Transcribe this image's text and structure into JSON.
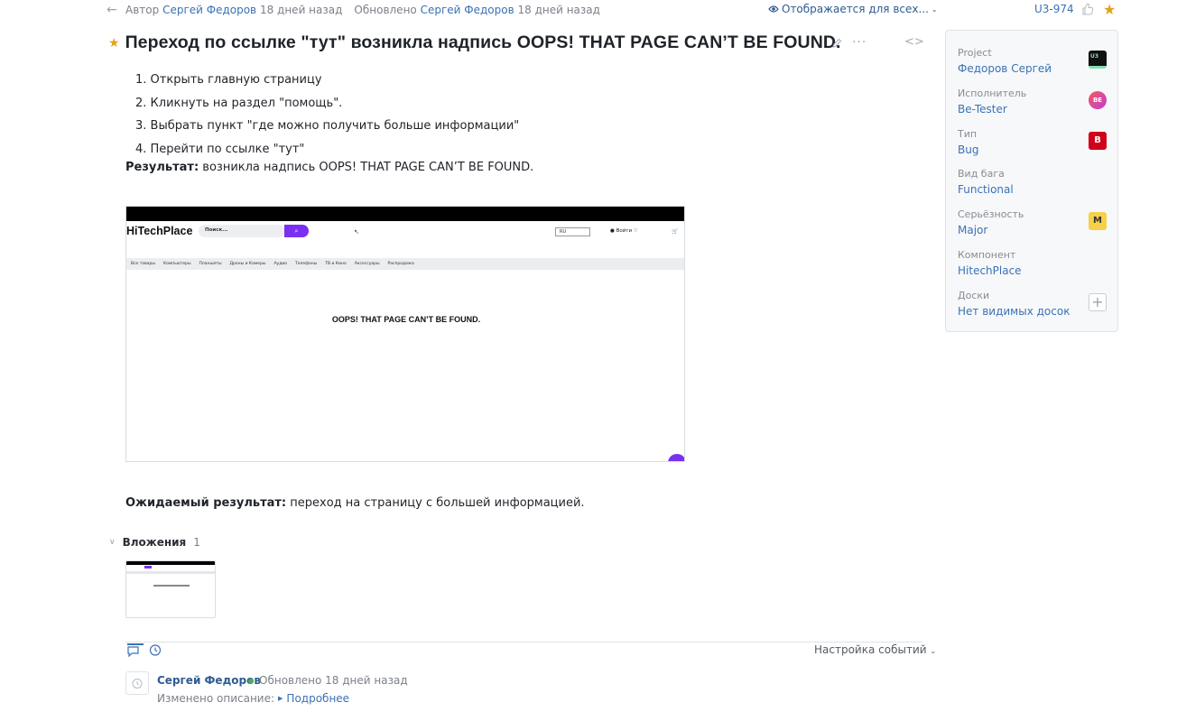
{
  "topbar": {
    "author_prefix": "Автор",
    "author_name": "Сергей Федоров",
    "author_time": "18 дней назад",
    "updated_prefix": "Обновлено",
    "updated_name": "Сергей Федоров",
    "updated_time": "18 дней назад",
    "visibility": "Отображается для всех...",
    "issue_id": "U3-974"
  },
  "issue": {
    "title": "Переход по ссылке \"тут\" возникла надпись OOPS! THAT PAGE CAN’T BE FOUND.",
    "steps": [
      "1. Открыть главную страницу",
      "2. Кликнуть на раздел \"помощь\".",
      "3. Выбрать пункт \"где можно получить больше информации\"",
      "4. Перейти по ссылке \"тут\""
    ],
    "result_label": "Результат:",
    "result_text": " возникла надпись OOPS! THAT PAGE CAN’T BE FOUND.",
    "expected_label": "Ожидаемый результат:",
    "expected_text": " переход на страницу с большей информацией."
  },
  "screenshot": {
    "logo": "HiTechPlace",
    "search_placeholder": "Поиск...",
    "lang": "RU",
    "login": "Войти",
    "nav": [
      "Все товары",
      "Компьютеры",
      "Планшеты",
      "Дроны и Камеры",
      "Аудио",
      "Телефоны",
      "ТВ и Кино",
      "Аксессуары",
      "Распродажа"
    ],
    "message": "OOPS! THAT PAGE CAN’T BE FOUND."
  },
  "attachments": {
    "label": "Вложения",
    "count": "1"
  },
  "activity": {
    "event_settings": "Настройка событий",
    "entry": {
      "author": "Сергей Федоров",
      "updated": "Обновлено 18 дней назад",
      "change_label": "Изменено описание:",
      "details_link": "Подробнее"
    }
  },
  "sidebar": {
    "fields": [
      {
        "label": "Project",
        "value": "Федоров Сергей",
        "badge": "U3",
        "badge_bg": "#111111",
        "badge_fg": "#7fe0b0"
      },
      {
        "label": "Исполнитель",
        "value": "Be-Tester",
        "badge": "BE",
        "badge_bg": "#e8467c",
        "badge_fg": "#ffffff"
      },
      {
        "label": "Тип",
        "value": "Bug",
        "badge": "B",
        "badge_bg": "#d0021b",
        "badge_fg": "#ffffff"
      },
      {
        "label": "Вид бага",
        "value": "Functional",
        "badge": "",
        "badge_bg": "",
        "badge_fg": ""
      },
      {
        "label": "Серьёзность",
        "value": "Major",
        "badge": "M",
        "badge_bg": "#f7d04a",
        "badge_fg": "#333333"
      },
      {
        "label": "Компонент",
        "value": "HitechPlace",
        "badge": "",
        "badge_bg": "",
        "badge_fg": ""
      },
      {
        "label": "Доски",
        "value": "Нет видимых досок",
        "badge": "+",
        "badge_bg": "",
        "badge_fg": "#9aa4b0"
      }
    ]
  },
  "colors": {
    "accent": "#3a72b5",
    "star": "#e4a31c"
  }
}
